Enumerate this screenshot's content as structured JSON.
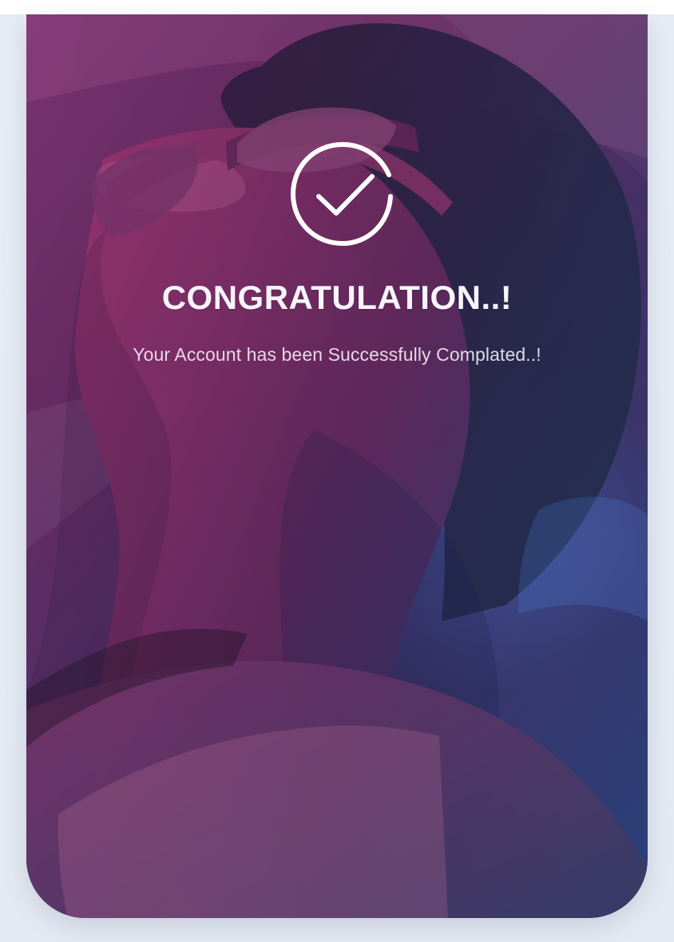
{
  "screen": {
    "title": "CONGRATULATION..!",
    "message": "Your Account has been Successfully Complated..!",
    "icon": "check-circle-icon",
    "background_photo": "portrait-photo"
  },
  "colors": {
    "overlay_magenta": "#6f2d67",
    "overlay_navy": "#263b72",
    "text_primary": "#f7f4fb",
    "text_secondary": "#f7f0fa",
    "page_background": "#e6ebf3"
  }
}
